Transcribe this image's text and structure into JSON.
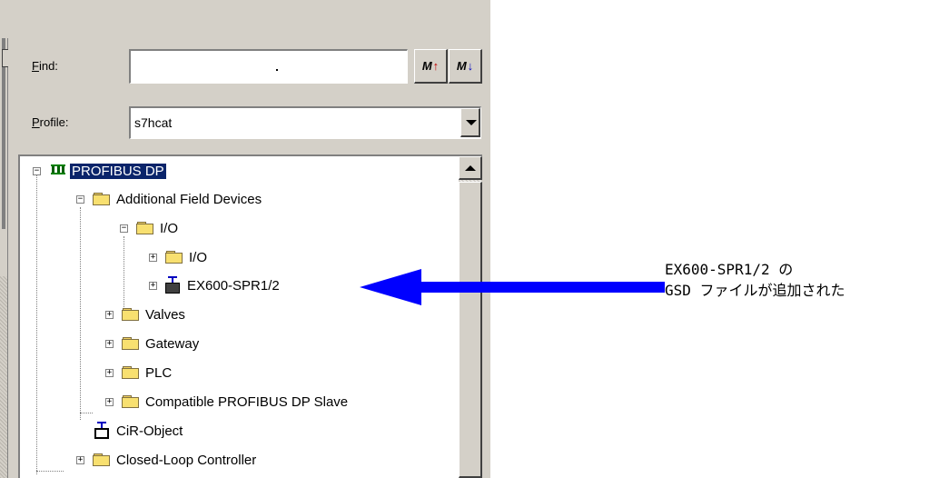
{
  "find": {
    "label": "Find:",
    "accel": "F",
    "rest": "ind:",
    "value": ""
  },
  "find_buttons": {
    "up_glyph": "M",
    "down_glyph": "M",
    "up_arrow": "↑",
    "down_arrow": "↓"
  },
  "profile": {
    "label": "Profile:",
    "accel": "P",
    "rest": "rofile:",
    "value": "s7hcat"
  },
  "tree": {
    "root": "PROFIBUS DP",
    "additional": "Additional Field Devices",
    "io_folder": "I/O",
    "io_sub": "I/O",
    "ex600": "EX600-SPR1/2",
    "valves": "Valves",
    "gateway": "Gateway",
    "plc": "PLC",
    "compatible": "Compatible PROFIBUS DP Slave",
    "cir": "CiR-Object",
    "closed_loop": "Closed-Loop Controller"
  },
  "callout": {
    "line1": "EX600-SPR1/2 の",
    "line2": "GSD ファイルが追加された"
  },
  "colors": {
    "arrow": "#0000ff",
    "selection": "#0a246a",
    "chrome": "#d4d0c8"
  },
  "icons": {
    "network": "profibus-network-icon",
    "folder": "folder-icon",
    "device": "slave-device-icon"
  }
}
